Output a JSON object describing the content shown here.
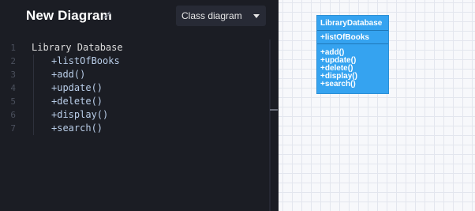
{
  "header": {
    "title": "New Diagram",
    "diagram_type": "Class diagram"
  },
  "editor": {
    "line_numbers": [
      "1",
      "2",
      "3",
      "4",
      "5",
      "6",
      "7"
    ],
    "class_name": "Library Database",
    "members": [
      "+listOfBooks",
      "+add()",
      "+update()",
      "+delete()",
      "+display()",
      "+search()"
    ]
  },
  "diagram": {
    "class_name": "LibraryDatabase",
    "attributes": [
      "+listOfBooks"
    ],
    "methods": [
      "+add()",
      "+update()",
      "+delete()",
      "+display()",
      "+search()"
    ],
    "class_color": "#35a3f0"
  },
  "icons": {
    "edit": "pencil-icon",
    "dropdown": "chevron-down-icon"
  }
}
